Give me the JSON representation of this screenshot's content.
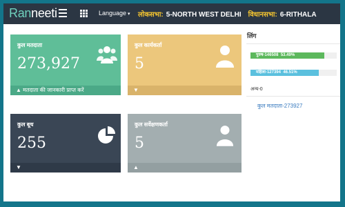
{
  "app": {
    "logo_left": "Ran",
    "logo_right": "neeti"
  },
  "header": {
    "language_label": "Language",
    "lok_sabha_label": "लोकसभा:",
    "lok_sabha_value": "5-NORTH WEST DELHI",
    "vidhan_sabha_label": "विधानसभा:",
    "vidhan_sabha_value": "6-RITHALA"
  },
  "tiles": {
    "voters": {
      "title": "कुल मतदाता",
      "value": "273,927",
      "footer": "▲ मतदाता की जानकारी प्राप्त करें",
      "icon": "users-icon"
    },
    "workers": {
      "title": "कुल कार्यकर्ता",
      "value": "5",
      "footer": "▼",
      "icon": "user-icon"
    },
    "booths": {
      "title": "कुल बूथ",
      "value": "255",
      "footer": "▼",
      "icon": "pie-chart-icon"
    },
    "surveyors": {
      "title": "कुल सर्वेक्षणकर्ता",
      "value": "5",
      "footer": "▲",
      "icon": "user-icon"
    }
  },
  "gender_panel": {
    "title": "लिंग",
    "male_label": "पुरुष-146508",
    "male_pct": "53.49%",
    "male_fraction": 0.5349,
    "female_label": "महिला-127394",
    "female_pct": "46.51%",
    "female_fraction": 0.4651,
    "other_label": "अन्य-0",
    "total_label": "कुल मतदाता-273927"
  },
  "colors": {
    "voters_tile": "#5fbe98",
    "workers_tile": "#ecc77c",
    "booths_tile": "#3a4655",
    "surveyors_tile": "#a3aeb0",
    "male_bar": "#5cb85c",
    "female_bar": "#5bc0de",
    "topbar": "#2b3643",
    "frame": "#13758a"
  }
}
